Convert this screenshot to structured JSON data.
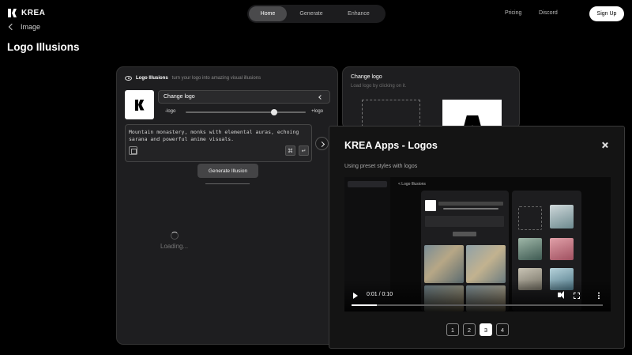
{
  "brand": {
    "name": "KREA"
  },
  "nav": {
    "tabs": [
      "Home",
      "Generate",
      "Enhance"
    ],
    "active_tab": "Home",
    "links": [
      "Pricing",
      "Discord"
    ],
    "signup_label": "Sign Up"
  },
  "back": {
    "label": "Image"
  },
  "page": {
    "title": "Logo Illusions"
  },
  "left_panel": {
    "title": "Logo Illusions",
    "subtitle": "turn your logo into amazing visual illusions",
    "change_logo_label": "Change logo",
    "slider_left": "-logo",
    "slider_right": "+logo",
    "slider_value": 0.74,
    "prompt": "Mountain monastery, monks with elemental auras, echoing sarana and powerful anime visuals.",
    "generate_label": "Generate Illusion",
    "loading_text": "Loading..."
  },
  "right_panel": {
    "title": "Change logo",
    "subtitle": "Load logo by clicking on it."
  },
  "modal": {
    "title": "KREA Apps - Logos",
    "subtitle": "Using preset styles with logos",
    "video": {
      "crumb": "< Logo Illusions",
      "time": "0:01 / 0:10",
      "progress": 0.1
    },
    "pages": [
      "1",
      "2",
      "3",
      "4"
    ],
    "active_page": "3"
  },
  "colors": {
    "background": "#000000",
    "panel": "#1e1e20",
    "accent": "#ffffff"
  }
}
